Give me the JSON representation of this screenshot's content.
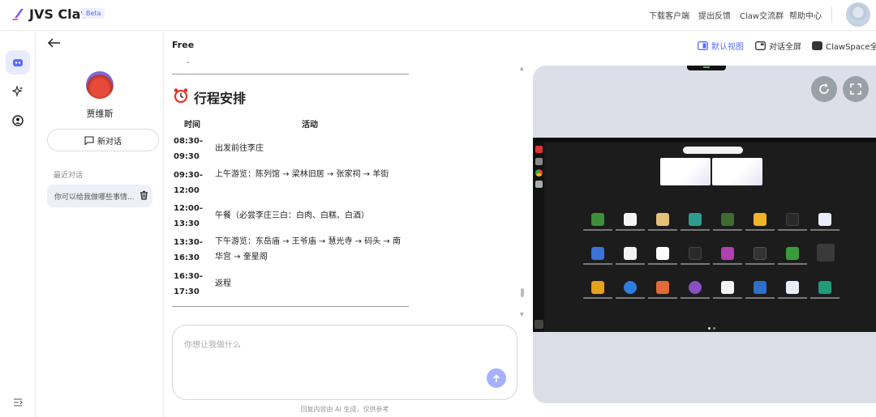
{
  "app": {
    "name": "JVS Claw",
    "badge": "Beta"
  },
  "topnav": {
    "download": "下载客户端",
    "feedback": "提出反馈",
    "community": "Claw交流群",
    "help": "帮助中心"
  },
  "sidebar": {
    "back_icon": "arrow-left-icon",
    "agent_name": "贾维斯",
    "new_chat": "新对话",
    "recent_label": "最近对话",
    "recent_item": "你可以给我做哪些事情..."
  },
  "chat": {
    "title": "Free",
    "dash": "-",
    "schedule_title": "行程安排",
    "table": {
      "headers": [
        "时间",
        "活动"
      ],
      "rows": [
        {
          "time": "08:30-09:30",
          "activity": "出发前往李庄"
        },
        {
          "time": "09:30-12:00",
          "activity": "上午游览：陈列馆 → 梁林旧居 → 张家祠 → 羊街"
        },
        {
          "time": "12:00-13:30",
          "activity": "午餐（必尝李庄三白：白肉、白糕、白酒）"
        },
        {
          "time": "13:30-16:30",
          "activity": "下午游览：东岳庙 → 王爷庙 → 慧光寺 → 码头 → 南华宫 → 奎星阁"
        },
        {
          "time": "16:30-17:30",
          "activity": "返程"
        }
      ]
    },
    "input_placeholder": "你想让我做什么",
    "disclaimer": "回复内容由 AI 生成，仅供参考"
  },
  "views": {
    "default": "默认视图",
    "fullscreen_chat": "对话全屏",
    "clawspace": "ClawSpace全屏"
  },
  "colors": {
    "accent": "#5b6cff",
    "send": "#a5b1ff",
    "preview_bg": "#dcdfe8"
  }
}
